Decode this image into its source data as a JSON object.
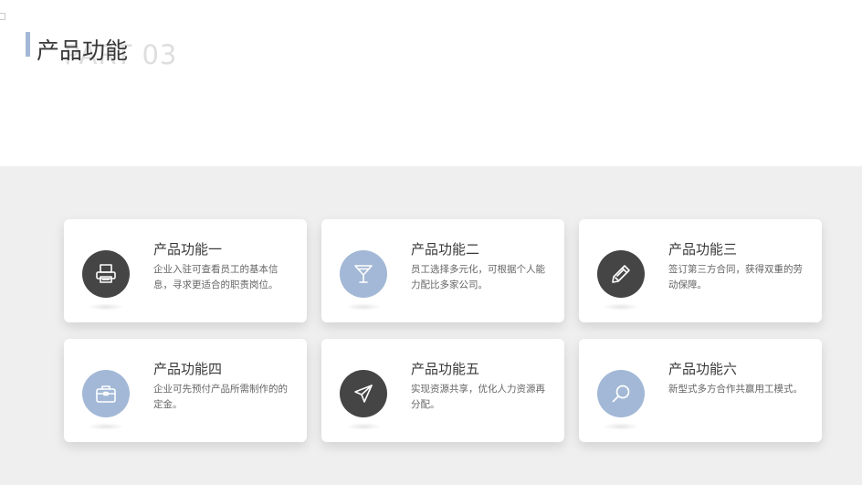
{
  "header": {
    "title": "产品功能",
    "background_text": "PART 03"
  },
  "colors": {
    "accent": "#a2b8d6",
    "dark_circle": "#454545",
    "band": "#efefef"
  },
  "cards": [
    {
      "title": "产品功能一",
      "desc": "企业入驻可查看员工的基本信息，寻求更适合的职责岗位。",
      "icon": "printer-icon"
    },
    {
      "title": "产品功能二",
      "desc": "员工选择多元化，可根据个人能力配比多家公司。",
      "icon": "cocktail-glass-icon"
    },
    {
      "title": "产品功能三",
      "desc": "签订第三方合同，获得双重的劳动保障。",
      "icon": "pencil-icon"
    },
    {
      "title": "产品功能四",
      "desc": "企业可先预付产品所需制作的的定金。",
      "icon": "briefcase-icon"
    },
    {
      "title": "产品功能五",
      "desc": "实现资源共享，优化人力资源再分配。",
      "icon": "paper-plane-icon"
    },
    {
      "title": "产品功能六",
      "desc": "新型式多方合作共赢用工模式。",
      "icon": "magnifier-icon"
    }
  ]
}
